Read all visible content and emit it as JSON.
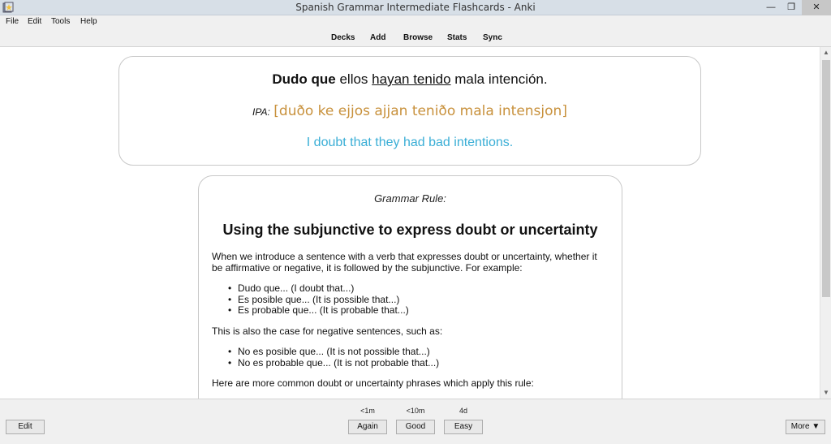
{
  "window": {
    "title": "Spanish Grammar Intermediate Flashcards - Anki",
    "min_symbol": "—",
    "max_symbol": "❐",
    "close_symbol": "✕"
  },
  "menubar": {
    "items": [
      "File",
      "Edit",
      "Tools",
      "Help"
    ]
  },
  "toolbar": {
    "items": [
      "Decks",
      "Add",
      "Browse",
      "Stats",
      "Sync"
    ]
  },
  "card": {
    "sentence": {
      "bold": "Dudo que",
      "text1": " ellos ",
      "underlined": "hayan tenido",
      "text2": " mala intención."
    },
    "ipa_label": "IPA:",
    "ipa": "[duðo ke ejjos ajjan teniðo mala intensjon]",
    "translation": "I doubt that they had bad intentions."
  },
  "rule": {
    "label": "Grammar Rule:",
    "title": "Using the subjunctive to express doubt or uncertainty",
    "intro": "When we introduce a sentence with a verb that expresses doubt or uncertainty, whether it be affirmative or negative, it is followed by the subjunctive. For example:",
    "examples": [
      "Dudo que... (I doubt that...)",
      "Es posible que... (It is possible that...)",
      "Es probable que... (It is probable that...)"
    ],
    "negative_intro": "This is also the case for negative sentences, such as:",
    "negative_examples": [
      "No es posible que... (It is not possible that...)",
      "No es probable que... (It is not probable that...)"
    ],
    "more": "Here are more common doubt or uncertainty phrases which apply this rule:"
  },
  "bottombar": {
    "edit_label": "Edit",
    "more_label": "More ▼",
    "answers": [
      {
        "interval": "<1m",
        "label": "Again"
      },
      {
        "interval": "<10m",
        "label": "Good"
      },
      {
        "interval": "4d",
        "label": "Easy"
      }
    ]
  },
  "scrollbar": {
    "up_symbol": "▲",
    "down_symbol": "▼"
  },
  "colors": {
    "ipa": "#c8913c",
    "translation": "#3aaed6"
  }
}
